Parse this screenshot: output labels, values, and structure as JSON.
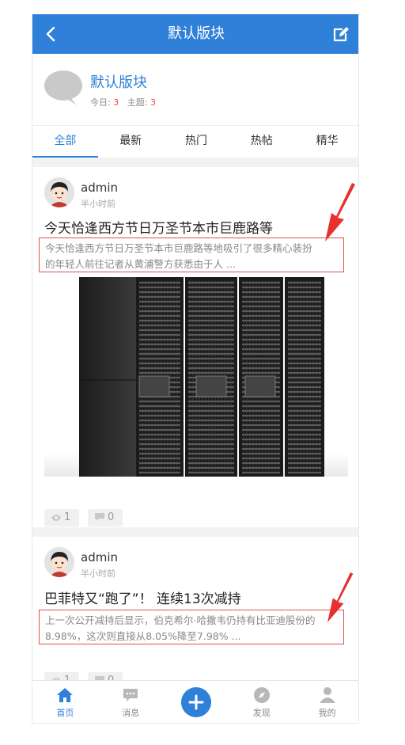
{
  "header": {
    "title": "默认版块",
    "back_icon": "back-arrow-icon",
    "edit_icon": "edit-icon"
  },
  "forum": {
    "name": "默认版块",
    "today_label": "今日:",
    "today_count": "3",
    "topics_label": "主题:",
    "topics_count": "3"
  },
  "tabs": [
    {
      "label": "全部",
      "active": true
    },
    {
      "label": "最新",
      "active": false
    },
    {
      "label": "热门",
      "active": false
    },
    {
      "label": "热帖",
      "active": false
    },
    {
      "label": "精华",
      "active": false
    }
  ],
  "posts": [
    {
      "author": "admin",
      "time": "半小时前",
      "title": "今天恰逢西方节日万圣节本市巨鹿路等",
      "excerpt_line1": "今天恰逢西方节日万圣节本市巨鹿路等地吸引了很多精心装扮",
      "excerpt_line2": "的年轻人前往记者从黄浦警方获悉由于人 ...",
      "views": "1",
      "comments": "0"
    },
    {
      "author": "admin",
      "time": "半小时前",
      "title": "巴菲特又“跑了”！ 连续13次减持",
      "excerpt_line1": "上一次公开减持后显示，伯克希尔·哈撒韦仍持有比亚迪股份的",
      "excerpt_line2": "8.98%，这次则直接从8.05%降至7.98% ...",
      "views": "1",
      "comments": "0"
    }
  ],
  "bottom_nav": [
    {
      "label": "首页",
      "icon": "home-icon",
      "active": true
    },
    {
      "label": "消息",
      "icon": "message-icon",
      "active": false
    },
    {
      "label": "",
      "icon": "plus-icon",
      "active": false
    },
    {
      "label": "发现",
      "icon": "compass-icon",
      "active": false
    },
    {
      "label": "我的",
      "icon": "user-icon",
      "active": false
    }
  ],
  "colors": {
    "accent": "#2f80d8",
    "highlight_border": "#d9534f",
    "arrow": "#e8312f",
    "count_red": "#e44444"
  }
}
